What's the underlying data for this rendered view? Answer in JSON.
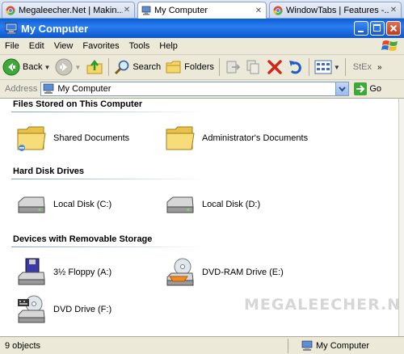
{
  "tabs": [
    {
      "label": "Megaleecher.Net | Makin...",
      "icon": "chrome-icon",
      "active": false
    },
    {
      "label": "My Computer",
      "icon": "my-computer-icon",
      "active": true
    },
    {
      "label": "WindowTabs | Features -...",
      "icon": "chrome-icon",
      "active": false
    }
  ],
  "window": {
    "title": "My Computer"
  },
  "menu": [
    "File",
    "Edit",
    "View",
    "Favorites",
    "Tools",
    "Help"
  ],
  "toolbar": {
    "back_label": "Back",
    "search_label": "Search",
    "folders_label": "Folders",
    "extra_label": "StEx"
  },
  "address": {
    "label": "Address",
    "value": "My Computer",
    "go_label": "Go"
  },
  "groups": [
    {
      "heading": "Files Stored on This Computer",
      "items": [
        {
          "label": "Shared Documents",
          "icon": "folder-icon"
        },
        {
          "label": "Administrator's Documents",
          "icon": "folder-icon"
        }
      ]
    },
    {
      "heading": "Hard Disk Drives",
      "items": [
        {
          "label": "Local Disk (C:)",
          "icon": "hard-disk-icon"
        },
        {
          "label": "Local Disk (D:)",
          "icon": "hard-disk-icon"
        }
      ]
    },
    {
      "heading": "Devices with Removable Storage",
      "items": [
        {
          "label": "3½ Floppy (A:)",
          "icon": "floppy-drive-icon"
        },
        {
          "label": "DVD-RAM Drive (E:)",
          "icon": "dvd-ram-drive-icon"
        },
        {
          "label": "DVD Drive (F:)",
          "icon": "dvd-drive-icon"
        }
      ]
    }
  ],
  "watermark": "MEGALEECHER.NET",
  "status": {
    "left": "9 objects",
    "right": "My Computer"
  },
  "colors": {
    "titlebar": "#0a5fd8",
    "menubar": "#ece9d8",
    "group_line": "#7da2ce"
  }
}
